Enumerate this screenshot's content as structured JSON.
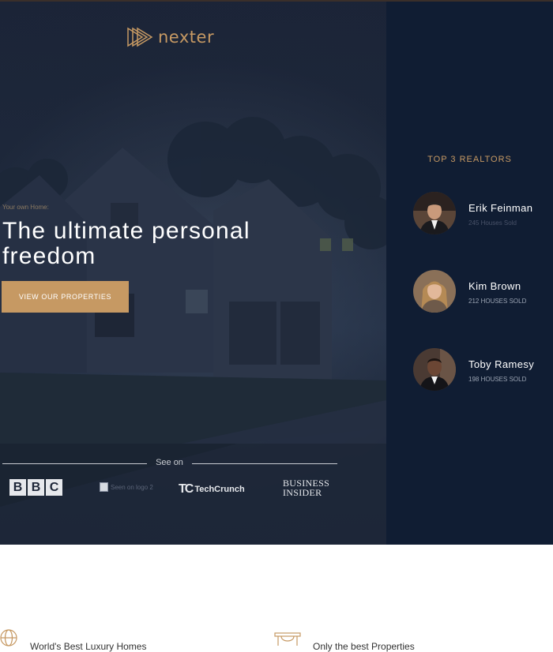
{
  "brand": {
    "name": "nexter",
    "accent": "#c69963",
    "navy": "#101d33"
  },
  "hero": {
    "eyebrow": "Your own Home:",
    "headline": "The ultimate personal freedom",
    "cta_label": "VIEW OUR PROPERTIES"
  },
  "seen_on": {
    "label": "See on",
    "logos": {
      "bbc": [
        "B",
        "B",
        "C"
      ],
      "broken_alt": "Seen on logo 2",
      "techcrunch_mark": "TC",
      "techcrunch_word": "TechCrunch",
      "business_insider": "BUSINESS INSIDER"
    }
  },
  "sidebar": {
    "title": "TOP 3 REALTORS",
    "realtors": [
      {
        "name": "Erik Feinman",
        "sold": "245 Houses Sold",
        "avatar_icon": "realtor-photo"
      },
      {
        "name": "Kim Brown",
        "sold": "212 HOUSES SOLD",
        "avatar_icon": "realtor-photo"
      },
      {
        "name": "Toby Ramesy",
        "sold": "198 HOUSES SOLD",
        "avatar_icon": "realtor-photo"
      }
    ]
  },
  "features": [
    {
      "label": "World's Best Luxury Homes",
      "icon": "globe-icon"
    },
    {
      "label": "Only the best Properties",
      "icon": "trophy-icon"
    }
  ]
}
